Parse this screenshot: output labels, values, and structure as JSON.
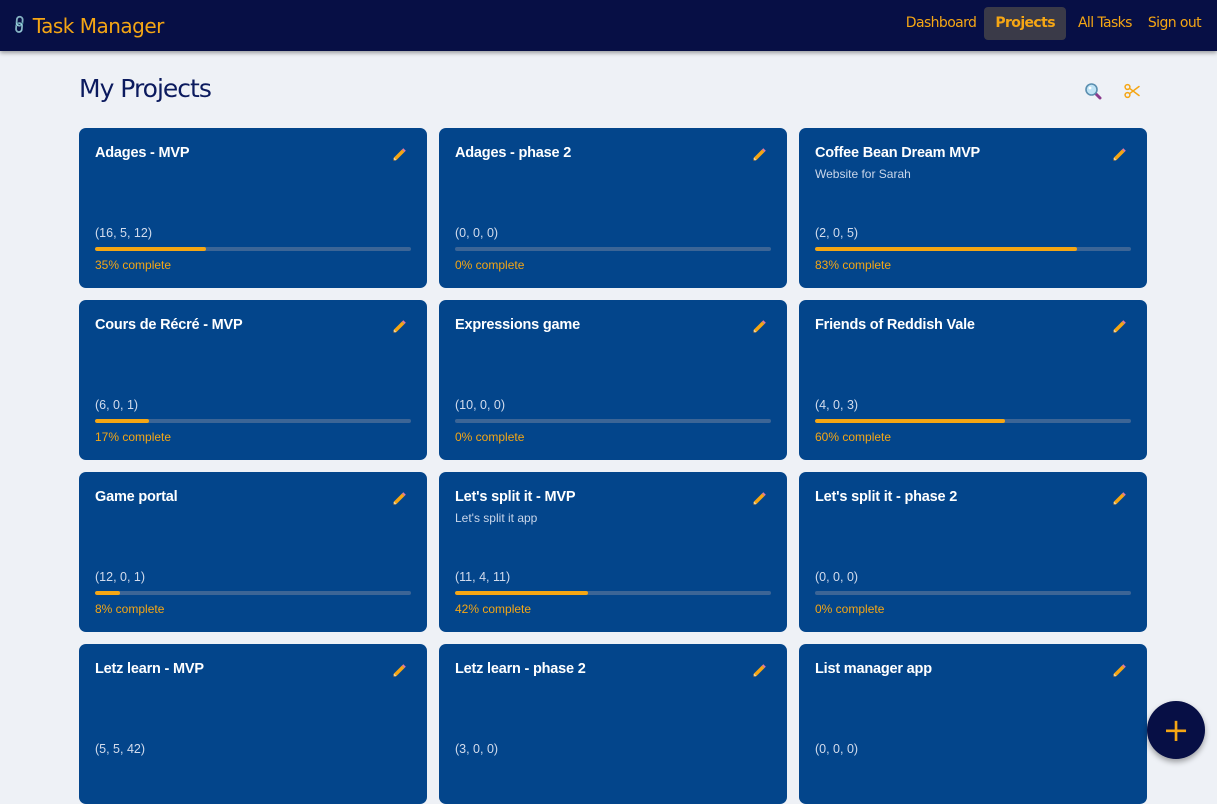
{
  "app": {
    "brand_icon": "link-icon",
    "title": "Task Manager"
  },
  "nav": [
    {
      "label": "Dashboard",
      "active": false
    },
    {
      "label": "Projects",
      "active": true
    },
    {
      "label": "All Tasks",
      "active": false
    },
    {
      "label": "Sign out",
      "active": false
    }
  ],
  "page": {
    "title": "My Projects",
    "tools": [
      {
        "name": "search-icon"
      },
      {
        "name": "scissors-icon"
      }
    ]
  },
  "colors": {
    "header": "#070f45",
    "accent": "#f5a614",
    "card": "#03458b",
    "background": "#eef1f6"
  },
  "projects": [
    {
      "title": "Adages - MVP",
      "description": "",
      "counts": "(16, 5, 12)",
      "progress": 35,
      "percent_label": "35% complete"
    },
    {
      "title": "Adages - phase 2",
      "description": "",
      "counts": "(0, 0, 0)",
      "progress": 0,
      "percent_label": "0% complete"
    },
    {
      "title": "Coffee Bean Dream MVP",
      "description": "Website for Sarah",
      "counts": "(2, 0, 5)",
      "progress": 83,
      "percent_label": "83% complete"
    },
    {
      "title": "Cours de Récré - MVP",
      "description": "",
      "counts": "(6, 0, 1)",
      "progress": 17,
      "percent_label": "17% complete"
    },
    {
      "title": "Expressions game",
      "description": "",
      "counts": "(10, 0, 0)",
      "progress": 0,
      "percent_label": "0% complete"
    },
    {
      "title": "Friends of Reddish Vale",
      "description": "",
      "counts": "(4, 0, 3)",
      "progress": 60,
      "percent_label": "60% complete"
    },
    {
      "title": "Game portal",
      "description": "",
      "counts": "(12, 0, 1)",
      "progress": 8,
      "percent_label": "8% complete"
    },
    {
      "title": "Let's split it - MVP",
      "description": "Let's split it app",
      "counts": "(11, 4, 11)",
      "progress": 42,
      "percent_label": "42% complete"
    },
    {
      "title": "Let's split it - phase 2",
      "description": "",
      "counts": "(0, 0, 0)",
      "progress": 0,
      "percent_label": "0% complete"
    },
    {
      "title": "Letz learn - MVP",
      "description": "",
      "counts": "(5, 5, 42)",
      "progress": null,
      "percent_label": ""
    },
    {
      "title": "Letz learn - phase 2",
      "description": "",
      "counts": "(3, 0, 0)",
      "progress": null,
      "percent_label": ""
    },
    {
      "title": "List manager app",
      "description": "",
      "counts": "(0, 0, 0)",
      "progress": null,
      "percent_label": ""
    }
  ],
  "fab": {
    "icon": "plus-icon",
    "label": "+"
  }
}
